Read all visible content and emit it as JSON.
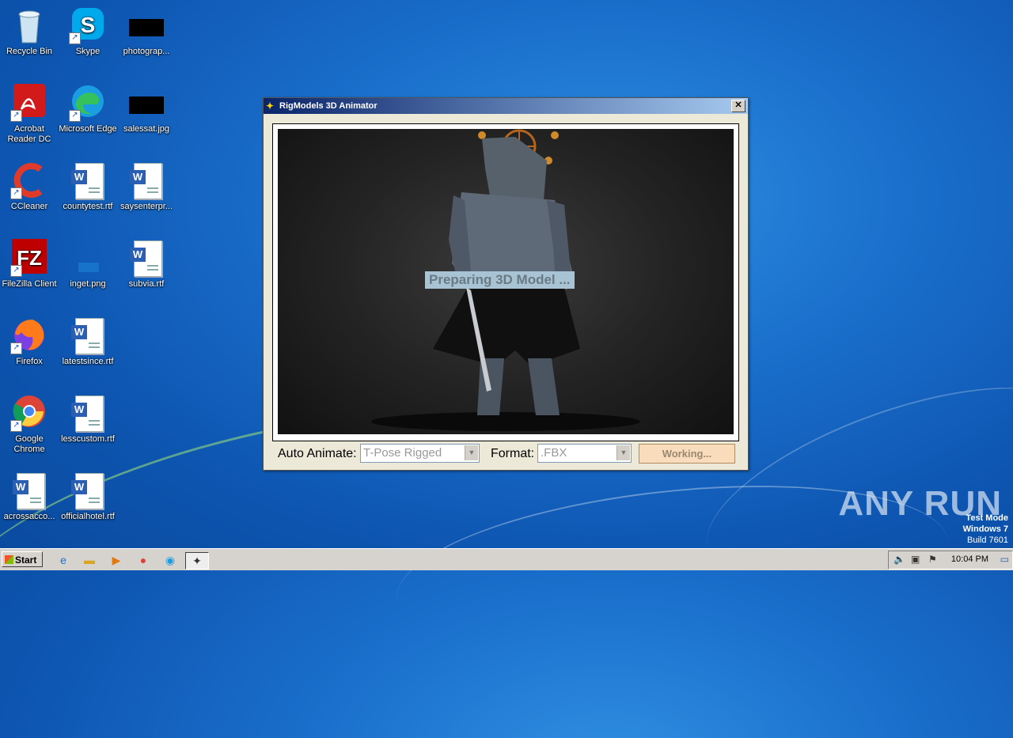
{
  "desktop": {
    "icons": [
      {
        "label": "Recycle Bin",
        "icon": "recycle-bin-icon"
      },
      {
        "label": "Skype",
        "icon": "skype-icon"
      },
      {
        "label": "photograp...",
        "icon": "image-file-icon"
      },
      {
        "label": "Acrobat Reader DC",
        "icon": "acrobat-icon"
      },
      {
        "label": "Microsoft Edge",
        "icon": "edge-icon"
      },
      {
        "label": "salessat.jpg",
        "icon": "image-file-icon"
      },
      {
        "label": "CCleaner",
        "icon": "ccleaner-icon"
      },
      {
        "label": "countytest.rtf",
        "icon": "word-doc-icon"
      },
      {
        "label": "saysenterpr...",
        "icon": "word-doc-icon"
      },
      {
        "label": "FileZilla Client",
        "icon": "filezilla-icon"
      },
      {
        "label": "inget.png",
        "icon": "image-file-icon"
      },
      {
        "label": "subvia.rtf",
        "icon": "word-doc-icon"
      },
      {
        "label": "Firefox",
        "icon": "firefox-icon"
      },
      {
        "label": "latestsince.rtf",
        "icon": "word-doc-icon"
      },
      {
        "label": "Google Chrome",
        "icon": "chrome-icon"
      },
      {
        "label": "lesscustom.rtf",
        "icon": "word-doc-icon"
      },
      {
        "label": "acrossacco...",
        "icon": "word-doc-icon"
      },
      {
        "label": "officialhotel.rtf",
        "icon": "word-doc-icon"
      }
    ]
  },
  "window": {
    "title": "RigModels 3D Animator",
    "close_symbol": "✕",
    "status_text": "Preparing 3D Model ...",
    "auto_animate_label": "Auto Animate:",
    "auto_animate_value": "T-Pose Rigged",
    "format_label": "Format:",
    "format_value": ".FBX",
    "working_button": "Working..."
  },
  "taskbar": {
    "start_label": "Start",
    "clock": "10:04 PM"
  },
  "watermark": "ANY RUN",
  "test_mode": {
    "line1": "Test Mode",
    "line2": "Windows 7",
    "line3": "Build 7601"
  }
}
